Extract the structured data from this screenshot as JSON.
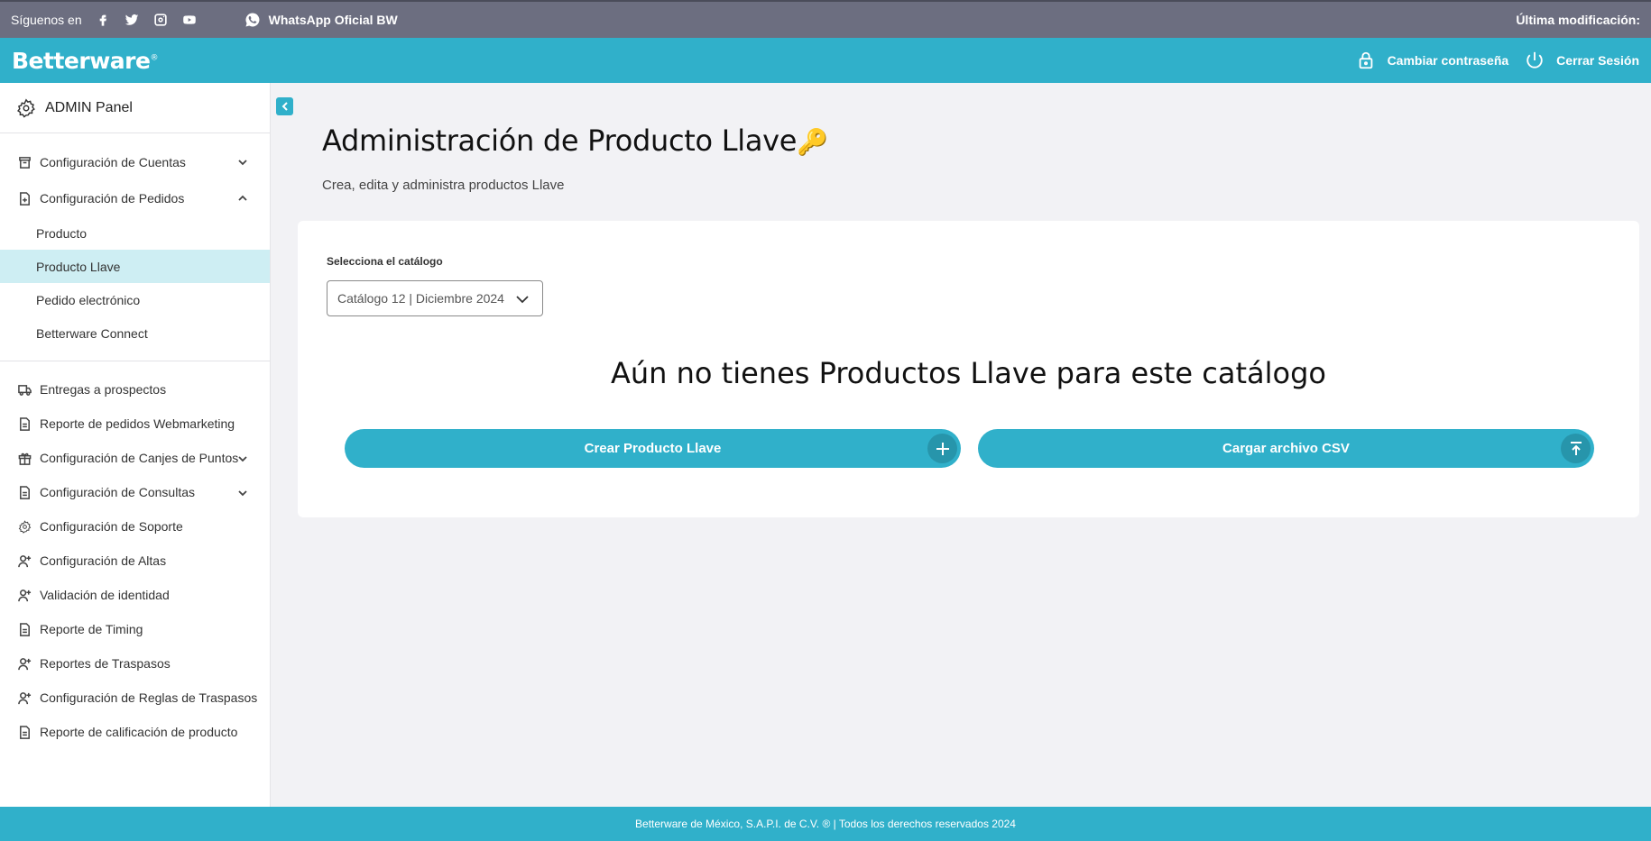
{
  "social_bar": {
    "follow_label": "Síguenos en",
    "icons": [
      "facebook-icon",
      "twitter-icon",
      "instagram-icon",
      "youtube-icon"
    ],
    "whatsapp_label": "WhatsApp Oficial BW",
    "last_modified_label": "Última modificación:"
  },
  "header": {
    "logo_text": "Betterware",
    "change_password": "Cambiar contraseña",
    "logout": "Cerrar Sesión"
  },
  "sidebar": {
    "panel_title": "ADMIN Panel",
    "items": [
      {
        "label": "Configuración de Cuentas",
        "icon": "archive-icon",
        "expandable": true,
        "expanded": false
      },
      {
        "label": "Configuración de Pedidos",
        "icon": "document-icon",
        "expandable": true,
        "expanded": true
      },
      {
        "label": "Producto"
      },
      {
        "label": "Producto Llave",
        "active": true
      },
      {
        "label": "Pedido electrónico"
      },
      {
        "label": "Betterware Connect"
      },
      {
        "label": "Entregas a prospectos",
        "icon": "truck-icon"
      },
      {
        "label": "Reporte de pedidos Webmarketing",
        "icon": "document-icon"
      },
      {
        "label": "Configuración de Canjes de Puntos",
        "icon": "gift-icon",
        "expandable": true
      },
      {
        "label": "Configuración de Consultas",
        "icon": "document-icon",
        "expandable": true
      },
      {
        "label": "Configuración de Soporte",
        "icon": "gear-icon"
      },
      {
        "label": "Configuración de Altas",
        "icon": "user-plus-icon"
      },
      {
        "label": "Validación de identidad",
        "icon": "user-plus-icon"
      },
      {
        "label": "Reporte de Timing",
        "icon": "document-icon"
      },
      {
        "label": "Reportes de Traspasos",
        "icon": "user-plus-icon"
      },
      {
        "label": "Configuración de Reglas de Traspasos",
        "icon": "user-plus-icon"
      },
      {
        "label": "Reporte de calificación de producto",
        "icon": "document-icon"
      }
    ]
  },
  "main": {
    "title": "Administración de Producto Llave",
    "title_emoji": "🔑",
    "subtitle": "Crea, edita y administra productos Llave",
    "catalog_label": "Selecciona el catálogo",
    "catalog_selected": "Catálogo 12 | Diciembre 2024",
    "empty_message": "Aún no tienes Productos Llave para este catálogo",
    "create_button": "Crear Producto Llave",
    "upload_button": "Cargar archivo CSV"
  },
  "footer": {
    "text": "Betterware de México, S.A.P.I. de C.V. ® | Todos los derechos reservados 2024"
  },
  "colors": {
    "primary": "#30b0ca",
    "top_bar": "#6c6e80",
    "active_item": "#ceeef3",
    "button_icon_bg": "#2795ab"
  }
}
